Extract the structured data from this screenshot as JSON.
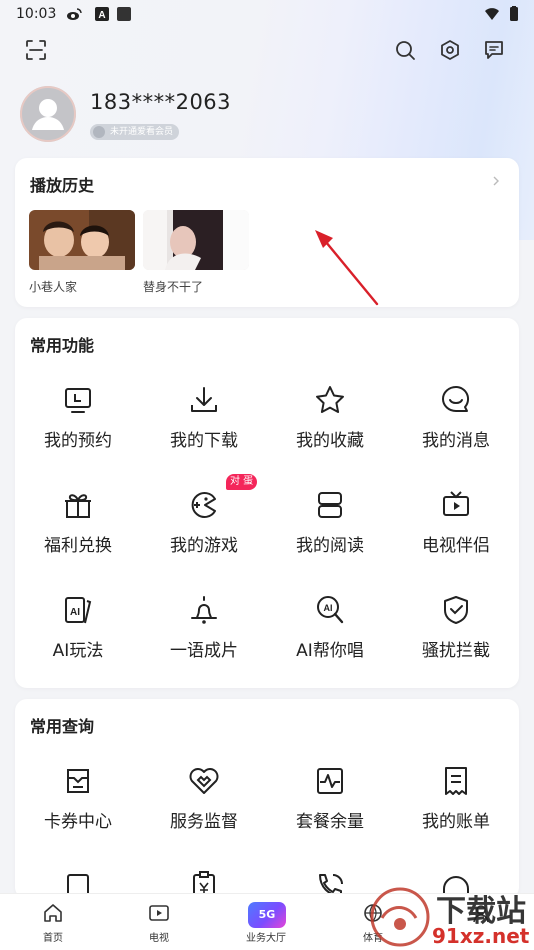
{
  "status": {
    "time": "10:03"
  },
  "profile": {
    "phone": "183****2063",
    "vip_label": "未开通爱看会员"
  },
  "history": {
    "title": "播放历史",
    "items": [
      {
        "label": "小巷人家"
      },
      {
        "label": "替身不干了"
      }
    ]
  },
  "common_functions": {
    "title": "常用功能",
    "items": [
      {
        "label": "我的预约",
        "icon": "tv-clock-icon"
      },
      {
        "label": "我的下载",
        "icon": "download-icon"
      },
      {
        "label": "我的收藏",
        "icon": "star-icon"
      },
      {
        "label": "我的消息",
        "icon": "message-smile-icon"
      },
      {
        "label": "福利兑换",
        "icon": "gift-icon"
      },
      {
        "label": "我的游戏",
        "icon": "game-icon"
      },
      {
        "label": "我的阅读",
        "icon": "book-icon"
      },
      {
        "label": "电视伴侣",
        "icon": "tv-play-icon"
      },
      {
        "label": "AI玩法",
        "icon": "ai-cards-icon"
      },
      {
        "label": "一语成片",
        "icon": "bell-icon"
      },
      {
        "label": "AI帮你唱",
        "icon": "ai-mic-icon"
      },
      {
        "label": "骚扰拦截",
        "icon": "shield-check-icon"
      }
    ],
    "game_badge": "对 蛋"
  },
  "common_queries": {
    "title": "常用查询",
    "items": [
      {
        "label": "卡券中心",
        "icon": "coupon-icon"
      },
      {
        "label": "服务监督",
        "icon": "heart-handshake-icon"
      },
      {
        "label": "套餐余量",
        "icon": "pulse-icon"
      },
      {
        "label": "我的账单",
        "icon": "bill-icon"
      }
    ]
  },
  "tabs": [
    {
      "label": "首页",
      "icon": "home-icon"
    },
    {
      "label": "电视",
      "icon": "tv-icon"
    },
    {
      "label": "业务大厅",
      "icon": "5g-icon",
      "badge": "5G"
    },
    {
      "label": "体育",
      "icon": "ball-icon"
    },
    {
      "label": "",
      "icon": "mine-icon"
    }
  ],
  "watermark": {
    "text": "下载站",
    "url_text": "91xz.net"
  },
  "colors": {
    "accent": "#f4265a",
    "text": "#222222",
    "arrow": "#d9202a"
  }
}
